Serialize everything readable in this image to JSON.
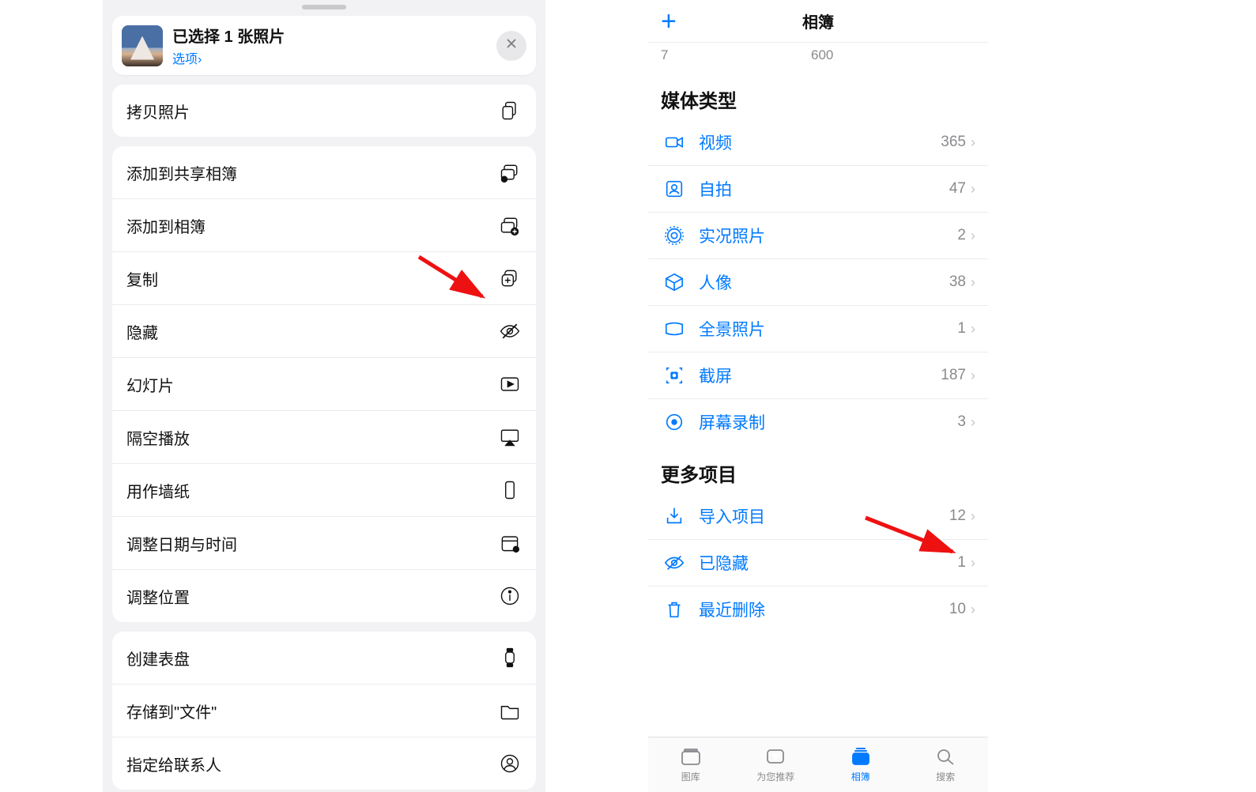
{
  "share": {
    "title": "已选择 1 张照片",
    "options": "选项",
    "options_chevron": "›",
    "groups": [
      {
        "items": [
          {
            "key": "copy_photo",
            "label": "拷贝照片",
            "icon": "copy-doc-icon"
          }
        ]
      },
      {
        "items": [
          {
            "key": "add_shared_album",
            "label": "添加到共享相簿",
            "icon": "shared-album-icon"
          },
          {
            "key": "add_album",
            "label": "添加到相簿",
            "icon": "add-album-icon"
          },
          {
            "key": "duplicate",
            "label": "复制",
            "icon": "duplicate-icon"
          },
          {
            "key": "hide",
            "label": "隐藏",
            "icon": "eye-slash-icon"
          },
          {
            "key": "slideshow",
            "label": "幻灯片",
            "icon": "play-rect-icon"
          },
          {
            "key": "airplay",
            "label": "隔空播放",
            "icon": "airplay-icon"
          },
          {
            "key": "wallpaper",
            "label": "用作墙纸",
            "icon": "phone-rect-icon"
          },
          {
            "key": "adjust_datetime",
            "label": "调整日期与时间",
            "icon": "calendar-dot-icon"
          },
          {
            "key": "adjust_location",
            "label": "调整位置",
            "icon": "info-circle-icon"
          }
        ]
      },
      {
        "items": [
          {
            "key": "create_watchface",
            "label": "创建表盘",
            "icon": "watch-icon"
          },
          {
            "key": "save_to_files",
            "label": "存储到\"文件\"",
            "icon": "folder-icon"
          },
          {
            "key": "assign_contact",
            "label": "指定给联系人",
            "icon": "person-circle-icon"
          }
        ]
      }
    ]
  },
  "albums": {
    "nav_title": "相簿",
    "partial": {
      "left": "7",
      "right": "600"
    },
    "section1_title": "媒体类型",
    "media_types": [
      {
        "label": "视频",
        "count": "365",
        "icon": "video-icon"
      },
      {
        "label": "自拍",
        "count": "47",
        "icon": "selfie-icon"
      },
      {
        "label": "实况照片",
        "count": "2",
        "icon": "livephoto-icon"
      },
      {
        "label": "人像",
        "count": "38",
        "icon": "cube-icon"
      },
      {
        "label": "全景照片",
        "count": "1",
        "icon": "panorama-icon"
      },
      {
        "label": "截屏",
        "count": "187",
        "icon": "screenshot-icon"
      },
      {
        "label": "屏幕录制",
        "count": "3",
        "icon": "record-icon"
      }
    ],
    "section2_title": "更多项目",
    "more_items": [
      {
        "label": "导入项目",
        "count": "12",
        "icon": "import-icon"
      },
      {
        "label": "已隐藏",
        "count": "1",
        "icon": "eye-slash-icon"
      },
      {
        "label": "最近删除",
        "count": "10",
        "icon": "trash-icon"
      }
    ],
    "tabs": [
      {
        "label": "图库",
        "icon": "library-icon",
        "active": false
      },
      {
        "label": "为您推荐",
        "icon": "for-you-icon",
        "active": false
      },
      {
        "label": "相簿",
        "icon": "albums-tab-icon",
        "active": true
      },
      {
        "label": "搜索",
        "icon": "search-icon",
        "active": false
      }
    ]
  }
}
